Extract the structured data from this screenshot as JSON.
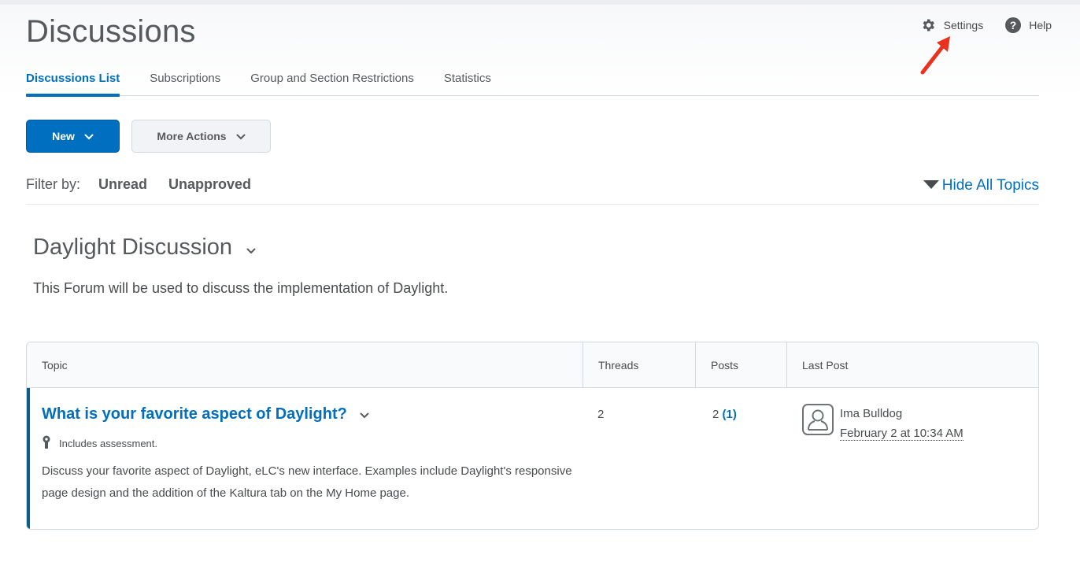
{
  "header": {
    "title": "Discussions",
    "links": [
      {
        "label": "Settings",
        "icon": "gear-icon"
      },
      {
        "label": "Help",
        "icon": "help-circle-icon"
      }
    ],
    "annotation": "red-arrow-pointing-to-settings"
  },
  "tabs": [
    {
      "label": "Discussions List",
      "active": true
    },
    {
      "label": "Subscriptions",
      "active": false
    },
    {
      "label": "Group and Section Restrictions",
      "active": false
    },
    {
      "label": "Statistics",
      "active": false
    }
  ],
  "toolbar": {
    "new_label": "New",
    "more_actions_label": "More Actions"
  },
  "filter": {
    "label": "Filter by:",
    "options": [
      "Unread",
      "Unapproved"
    ],
    "hide_all_label": "Hide All Topics"
  },
  "forum": {
    "title": "Daylight Discussion",
    "description": "This Forum will be used to discuss the implementation of Daylight."
  },
  "table": {
    "columns": [
      "Topic",
      "Threads",
      "Posts",
      "Last Post"
    ],
    "rows": [
      {
        "topic": "What is your favorite aspect of Daylight?",
        "assessment": "Includes assessment.",
        "description": "Discuss your favorite aspect of Daylight, eLC's new interface. Examples include Daylight's responsive page design and the addition of the Kaltura tab on the My Home page.",
        "threads": "2",
        "posts": "2",
        "unread_posts": "(1)",
        "last_post_author": "Ima Bulldog",
        "last_post_date": "February 2 at 10:34 AM"
      }
    ]
  },
  "colors": {
    "accent": "#006fbf",
    "row_accent": "#0b5f84",
    "annotation_arrow": "#e8321e"
  }
}
